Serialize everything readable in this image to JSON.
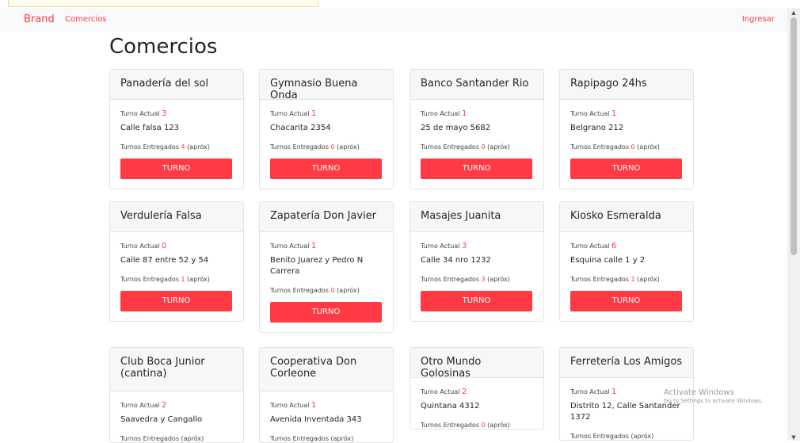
{
  "nav": {
    "brand": "Brand",
    "link": "Comercios",
    "login": "Ingresar"
  },
  "page": {
    "title": "Comercios"
  },
  "labels": {
    "turno_actual": "Turno Actual",
    "turnos_entregados": "Turnos Entregados",
    "aprox": "(apróx)",
    "button": "TURNO"
  },
  "cards": [
    {
      "name": "Panadería del sol",
      "turno": "3",
      "address": "Calle falsa 123",
      "entregados": "4"
    },
    {
      "name": "Gymnasio Buena Onda",
      "turno": "1",
      "address": "Chacarita 2354",
      "entregados": "0"
    },
    {
      "name": "Banco Santander Rio",
      "turno": "1",
      "address": "25 de mayo 5682",
      "entregados": "0"
    },
    {
      "name": "Rapipago 24hs",
      "turno": "1",
      "address": "Belgrano 212",
      "entregados": "0"
    },
    {
      "name": "Verdulería Falsa",
      "turno": "0",
      "address": "Calle 87 entre 52 y 54",
      "entregados": "1"
    },
    {
      "name": "Zapatería Don Javier",
      "turno": "1",
      "address": "Benito Juarez y Pedro N Carrera",
      "entregados": "0"
    },
    {
      "name": "Masajes Juanita",
      "turno": "3",
      "address": "Calle 34 nro 1232",
      "entregados": "3"
    },
    {
      "name": "Kiosko Esmeralda",
      "turno": "6",
      "address": "Esquina calle 1 y 2",
      "entregados": "1"
    },
    {
      "name": "Club Boca Junior (cantina)",
      "turno": "2",
      "address": "Saavedra y Cangallo",
      "entregados": ""
    },
    {
      "name": "Cooperativa Don Corleone",
      "turno": "1",
      "address": "Avenida Inventada 343",
      "entregados": ""
    },
    {
      "name": "Otro Mundo Golosinas",
      "turno": "2",
      "address": "Quintana 4312",
      "entregados": "0"
    },
    {
      "name": "Ferretería Los Amigos",
      "turno": "1",
      "address": "Distrito 12, Calle Santander 1372",
      "entregados": ""
    }
  ],
  "watermark": {
    "title": "Activate Windows",
    "subtitle": "Go to Settings to activate Windows."
  }
}
